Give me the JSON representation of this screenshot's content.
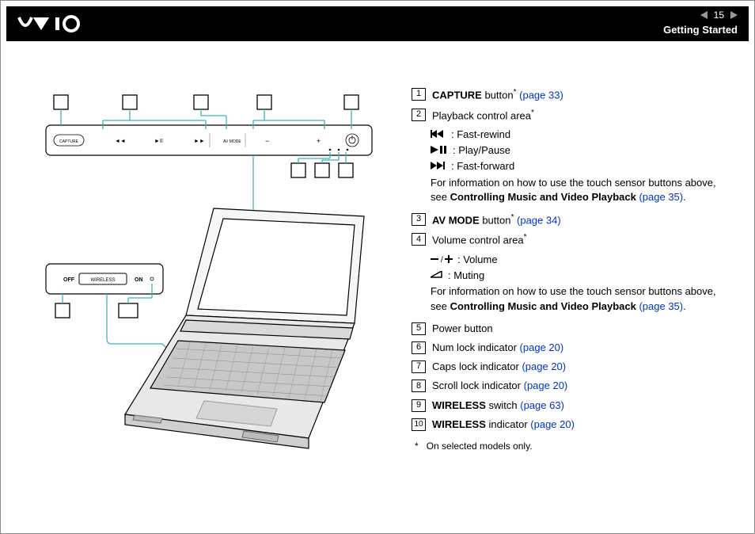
{
  "header": {
    "page": "15",
    "section": "Getting Started"
  },
  "diagram": {
    "panel_labels": {
      "capture": "CAPTURE",
      "avmode": "AV MODE",
      "off": "OFF",
      "on": "ON",
      "wireless": "WIRELESS"
    },
    "callouts": [
      "1",
      "2",
      "3",
      "4",
      "5",
      "6",
      "7",
      "8",
      "9",
      "10"
    ]
  },
  "legend": {
    "items": [
      {
        "num": "1",
        "bold": "CAPTURE",
        "text": " button",
        "star": true,
        "link": "(page 33)"
      },
      {
        "num": "2",
        "text": "Playback control area",
        "star": true,
        "subs": [
          {
            "icon": "rw",
            "label": ": Fast-rewind"
          },
          {
            "icon": "pp",
            "label": ": Play/Pause"
          },
          {
            "icon": "ff",
            "label": ": Fast-forward"
          }
        ],
        "note_pre": "For information on how to use the touch sensor buttons above, see ",
        "note_bold": "Controlling Music and Video Playback ",
        "note_link": "(page 35)",
        "note_post": "."
      },
      {
        "num": "3",
        "bold": "AV MODE",
        "text": " button",
        "star": true,
        "link": "(page 34)"
      },
      {
        "num": "4",
        "text": "Volume control area",
        "star": true,
        "subs": [
          {
            "icon": "vol",
            "label": ": Volume"
          },
          {
            "icon": "mute",
            "label": ": Muting"
          }
        ],
        "note_pre": "For information on how to use the touch sensor buttons above, see ",
        "note_bold": "Controlling Music and Video Playback ",
        "note_link": "(page 35)",
        "note_post": "."
      },
      {
        "num": "5",
        "text": "Power button"
      },
      {
        "num": "6",
        "text": "Num lock indicator ",
        "link": "(page 20)"
      },
      {
        "num": "7",
        "text": "Caps lock indicator ",
        "link": "(page 20)"
      },
      {
        "num": "8",
        "text": "Scroll lock indicator ",
        "link": "(page 20)"
      },
      {
        "num": "9",
        "bold": "WIRELESS",
        "text": " switch ",
        "link": "(page 63)"
      },
      {
        "num": "10",
        "bold": "WIRELESS",
        "text": " indicator ",
        "link": "(page 20)"
      }
    ],
    "footnote": "On selected models only.",
    "footnote_mark": "*"
  }
}
